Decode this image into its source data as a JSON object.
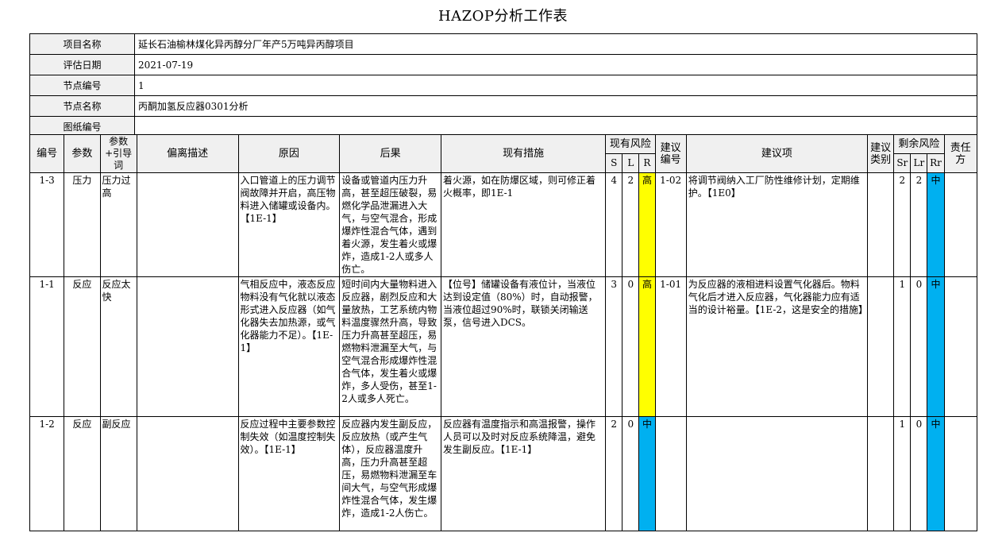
{
  "title": "HAZOP分析工作表",
  "info": {
    "project_label": "项目名称",
    "project_value": "延长石油榆林煤化异丙醇分厂年产5万吨异丙醇项目",
    "date_label": "评估日期",
    "date_value": "2021-07-19",
    "node_no_label": "节点编号",
    "node_no_value": "1",
    "node_name_label": "节点名称",
    "node_name_value": "丙酮加氢反应器0301分析",
    "drawing_label": "图纸编号",
    "drawing_value": ""
  },
  "headers": {
    "no": "编号",
    "param": "参数",
    "guide": "参数+引导词",
    "deviation": "偏离描述",
    "cause": "原因",
    "consequence": "后果",
    "measures": "现有措施",
    "existing_risk": "现有风险",
    "s": "S",
    "l": "L",
    "r": "R",
    "rec_no": "建议编号",
    "rec": "建议项",
    "rec_type": "建议类别",
    "residual_risk": "剩余风险",
    "sr": "Sr",
    "lr": "Lr",
    "rr": "Rr",
    "owner": "责任方"
  },
  "rows": [
    {
      "no": "1-3",
      "param": "压力",
      "guide": "压力过高",
      "deviation": "",
      "cause": "入口管道上的压力调节阀故障并开启，高压物料进入储罐或设备内。【1E-1】",
      "consequence": "设备或管道内压力升高，甚至超压破裂，易燃化学品泄漏进入大气，与空气混合，形成爆炸性混合气体，遇到着火源，发生着火或爆炸，造成1-2人或多人伤亡。",
      "measures": "着火源，如在防爆区域，则可修正着火概率，即1E-1",
      "s": "4",
      "l": "2",
      "r": "高",
      "rec_no": "1-02",
      "rec": "将调节阀纳入工厂防性维修计划，定期维护。【1E0】",
      "rec_type": "",
      "sr": "2",
      "lr": "2",
      "rr": "中",
      "owner": ""
    },
    {
      "no": "1-1",
      "param": "反应",
      "guide": "反应太快",
      "deviation": "",
      "cause": "气相反应中，液态反应物料没有气化就以液态形式进入反应器（如气化器失去加热源，或气化器能力不足）。【1E-1】",
      "consequence": "短时间内大量物料进入反应器，剧烈反应和大量放热，工艺系统内物料温度骤然升高，导致压力升高甚至超压，易燃物料泄漏至大气，与空气混合形成爆炸性混合气体，发生着火或爆炸，多人受伤，甚至1-2人或多人死亡。",
      "measures": "【位号】储罐设备有液位计，当液位达到设定值（80%）时，自动报警，当液位超过90%时，联锁关闭输送泵，信号进入DCS。",
      "s": "3",
      "l": "0",
      "r": "高",
      "rec_no": "1-01",
      "rec": "为反应器的液相进料设置气化器后。物料气化后才进入反应器，气化器能力应有适当的设计裕量。【1E-2，这是安全的措施】",
      "rec_type": "",
      "sr": "1",
      "lr": "0",
      "rr": "中",
      "owner": ""
    },
    {
      "no": "1-2",
      "param": "反应",
      "guide": "副反应",
      "deviation": "",
      "cause": "反应过程中主要参数控制失效（如温度控制失效）。【1E-1】",
      "consequence": "反应器内发生副反应，反应放热（或产生气体），反应器温度升高，压力升高甚至超压，易燃物料泄漏至车间大气，与空气形成爆炸性混合气体，发生爆炸，造成1-2人伤亡。",
      "measures": "反应器有温度指示和高温报警，操作人员可以及时对反应系统降温，避免发生副反应。【1E-1】",
      "s": "2",
      "l": "0",
      "r": "中",
      "rec_no": "",
      "rec": "",
      "rec_type": "",
      "sr": "1",
      "lr": "0",
      "rr": "中",
      "owner": ""
    }
  ],
  "colors": {
    "high": "#ffff00",
    "medium": "#00b0f0"
  }
}
